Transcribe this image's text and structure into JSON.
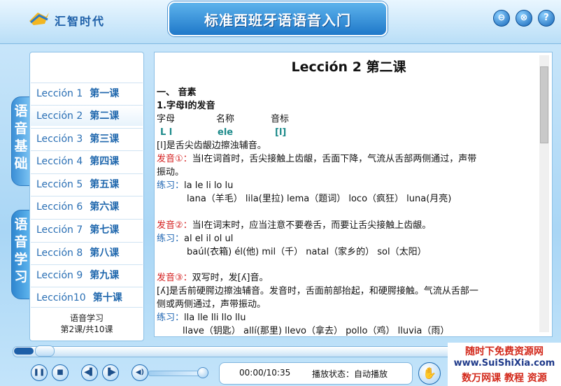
{
  "header": {
    "app_name": "汇智时代",
    "title": "标准西班牙语语音入门",
    "buttons": [
      "⊖",
      "⊗",
      "?"
    ]
  },
  "sidebar": {
    "tabs": [
      "语音基础",
      "语音学习"
    ],
    "lessons": [
      {
        "en": "Lección 1",
        "cn": "第一课"
      },
      {
        "en": "Lección 2",
        "cn": "第二课"
      },
      {
        "en": "Lección 3",
        "cn": "第三课"
      },
      {
        "en": "Lección 4",
        "cn": "第四课"
      },
      {
        "en": "Lección 5",
        "cn": "第五课"
      },
      {
        "en": "Lección 6",
        "cn": "第六课"
      },
      {
        "en": "Lección 7",
        "cn": "第七课"
      },
      {
        "en": "Lección 8",
        "cn": "第八课"
      },
      {
        "en": "Lección 9",
        "cn": "第九课"
      },
      {
        "en": "Lección10",
        "cn": "第十课"
      }
    ],
    "status_line1": "语音学习",
    "status_line2": "第2课/共10课"
  },
  "content": {
    "title": "Lección 2 第二课",
    "section": "一、    音素",
    "subsection": "1.字母l的发音",
    "col_letter": "字母",
    "col_name": "名称",
    "col_sound": "音标",
    "letter": "L l",
    "name": "ele",
    "sound": "[l]",
    "desc": "[l]是舌尖齿龈边擦浊辅音。",
    "p1_label": "发音①：",
    "p1_text": "当l在词首时，舌尖接触上齿龈，舌面下降，气流从舌部两侧通过，声带",
    "p1_text2": "振动。",
    "ex_label": "练习：",
    "ex1_a": "la le li lo lu",
    "ex1_b": "lana（羊毛） lila(里拉)  lema（题词） loco（疯狂） luna(月亮)",
    "p2_label": "发音②：",
    "p2_text": "当l在词末时，应当注意不要卷舌，而要让舌尖接触上齿龈。",
    "ex2_a": "al el il ol ul",
    "ex2_b": "baúl(衣箱)  él(他)  mil（千） natal（家乡的） sol（太阳）",
    "p3_label": "发音③：",
    "p3_text": "双写时，发[ʎ]音。",
    "p3_desc": "[ʎ]是舌前硬腭边擦浊辅音。发音时，舌面前部抬起，和硬腭接触。气流从舌部一",
    "p3_desc2": "侧或两侧通过，声带振动。",
    "ex3_a": "lla lle lli llo llu",
    "ex3_b": "llave（钥匙） allí(那里)  llevo（拿去） pollo（鸡） lluvia（雨）"
  },
  "player": {
    "time": "00:00/10:35",
    "state": "播放状态：自动播放"
  },
  "watermark": {
    "line1": "随时下免费资源网",
    "line2": "www.SuiShiXia.com",
    "line3": "数万网课 教程 资源"
  }
}
